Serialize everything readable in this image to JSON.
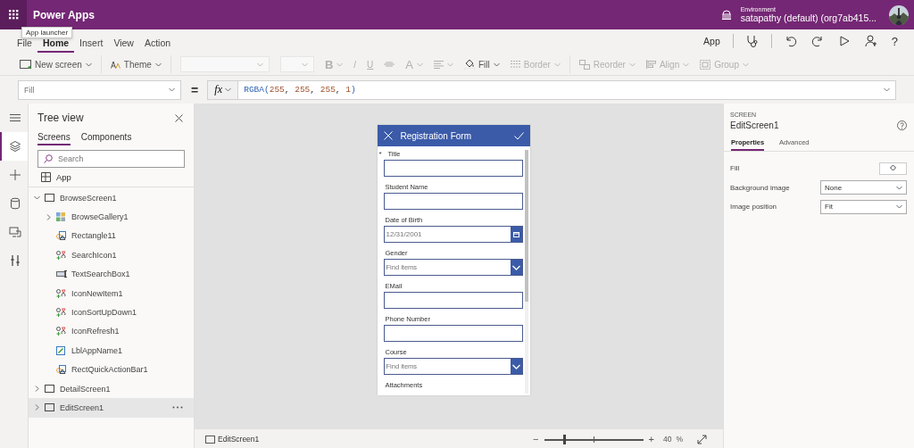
{
  "app_bar": {
    "title": "Power Apps",
    "environment_label": "Environment",
    "environment": "satapathy (default) (org7ab415..."
  },
  "tooltip": {
    "text": "App launcher"
  },
  "menu": [
    {
      "label": "File",
      "selected": false
    },
    {
      "label": "Home",
      "selected": true
    },
    {
      "label": "Insert",
      "selected": false
    },
    {
      "label": "View",
      "selected": false
    },
    {
      "label": "Action",
      "selected": false
    }
  ],
  "menu_tools": [
    {
      "kind": "text",
      "label": "App"
    },
    {
      "kind": "checker"
    },
    {
      "kind": "undo"
    },
    {
      "kind": "redo"
    },
    {
      "kind": "play"
    },
    {
      "kind": "share"
    },
    {
      "kind": "help",
      "label": "?"
    }
  ],
  "toolbar": [
    {
      "kind": "new-screen",
      "label": "New screen",
      "caret": true,
      "disabled": false
    },
    {
      "kind": "theme",
      "label": "Theme",
      "caret": true,
      "disabled": false
    },
    {
      "kind": "font-select",
      "caret": true,
      "disabled": true
    },
    {
      "kind": "size-select",
      "caret": true,
      "disabled": true
    },
    {
      "kind": "bold",
      "label": "B",
      "caret": true,
      "disabled": true
    },
    {
      "kind": "italic",
      "label": "/",
      "caret": false,
      "disabled": true
    },
    {
      "kind": "underline",
      "label": "U",
      "caret": false,
      "disabled": true
    },
    {
      "kind": "strike",
      "caret": false,
      "disabled": true
    },
    {
      "kind": "font-color",
      "label": "A",
      "caret": true,
      "disabled": true
    },
    {
      "kind": "align-text",
      "caret": true,
      "disabled": true
    },
    {
      "kind": "fill",
      "label": "Fill",
      "caret": true,
      "disabled": false
    },
    {
      "kind": "border",
      "label": "Border",
      "caret": true,
      "disabled": true
    },
    {
      "kind": "reorder",
      "label": "Reorder",
      "caret": true,
      "disabled": true
    },
    {
      "kind": "align",
      "label": "Align",
      "caret": true,
      "disabled": true
    },
    {
      "kind": "group",
      "label": "Group",
      "caret": true,
      "disabled": true
    }
  ],
  "formula_bar": {
    "property": "Fill",
    "equals": "=",
    "fx": "fx",
    "formula": [
      {
        "kind": "function",
        "text": "RGBA("
      },
      {
        "kind": "number",
        "text": "255"
      },
      {
        "kind": "punct",
        "text": ", "
      },
      {
        "kind": "number",
        "text": "255"
      },
      {
        "kind": "punct",
        "text": ", "
      },
      {
        "kind": "number",
        "text": "255"
      },
      {
        "kind": "punct",
        "text": ", "
      },
      {
        "kind": "number",
        "text": "1"
      },
      {
        "kind": "function",
        "text": ")"
      }
    ]
  },
  "rail": [
    {
      "kind": "menu",
      "selected": false
    },
    {
      "kind": "layers",
      "selected": true
    },
    {
      "kind": "insert",
      "selected": false
    },
    {
      "kind": "data",
      "selected": false
    },
    {
      "kind": "media",
      "selected": false
    },
    {
      "kind": "tools",
      "selected": false
    }
  ],
  "tree_view": {
    "title": "Tree view",
    "tabs": [
      {
        "label": "Screens",
        "selected": true
      },
      {
        "label": "Components",
        "selected": false
      }
    ],
    "search": {
      "placeholder": "Search"
    },
    "app_item": "App",
    "nodes": [
      {
        "label": "BrowseScreen1",
        "kind": "screen",
        "expanded": true,
        "selected": false,
        "children": [
          {
            "label": "BrowseGallery1",
            "kind": "gallery",
            "expanded": false,
            "selected": false
          },
          {
            "label": "Rectangle11",
            "kind": "shape",
            "selected": false
          },
          {
            "label": "SearchIcon1",
            "kind": "icon",
            "selected": false
          },
          {
            "label": "TextSearchBox1",
            "kind": "text-input",
            "selected": false
          },
          {
            "label": "IconNewItem1",
            "kind": "icon",
            "selected": false
          },
          {
            "label": "IconSortUpDown1",
            "kind": "icon",
            "selected": false
          },
          {
            "label": "IconRefresh1",
            "kind": "icon",
            "selected": false
          },
          {
            "label": "LblAppName1",
            "kind": "label",
            "selected": false
          },
          {
            "label": "RectQuickActionBar1",
            "kind": "shape",
            "selected": false
          }
        ]
      },
      {
        "label": "DetailScreen1",
        "kind": "screen",
        "expanded": false,
        "selected": false
      },
      {
        "label": "EditScreen1",
        "kind": "screen",
        "expanded": false,
        "selected": true
      }
    ]
  },
  "form": {
    "title": "Registration Form",
    "required_mark": "*",
    "fields": [
      {
        "kind": "text",
        "label": "Title",
        "required": true
      },
      {
        "kind": "text",
        "label": "Student Name",
        "required": false
      },
      {
        "kind": "date",
        "label": "Date of Birth",
        "required": false,
        "value": "12/31/2001"
      },
      {
        "kind": "combo",
        "label": "Gender",
        "required": false,
        "placeholder": "Find items"
      },
      {
        "kind": "text",
        "label": "EMail",
        "required": false
      },
      {
        "kind": "text",
        "label": "Phone Number",
        "required": false
      },
      {
        "kind": "combo",
        "label": "Course",
        "required": false,
        "placeholder": "Find items"
      },
      {
        "kind": "attachments",
        "label": "Attachments",
        "required": false
      }
    ]
  },
  "properties": {
    "type_label": "SCREEN",
    "name": "EditScreen1",
    "tabs": [
      {
        "label": "Properties",
        "selected": true
      },
      {
        "label": "Advanced",
        "selected": false
      }
    ],
    "rows": [
      {
        "kind": "color",
        "label": "Fill"
      },
      {
        "kind": "dropdown",
        "label": "Background image",
        "value": "None"
      },
      {
        "kind": "dropdown",
        "label": "Image position",
        "value": "Fit"
      }
    ]
  },
  "status_bar": {
    "screen": "EditScreen1",
    "minus": "−",
    "plus": "+",
    "zoom": {
      "level": 0.2
    },
    "percent_value": "40",
    "percent_sign": "%"
  }
}
